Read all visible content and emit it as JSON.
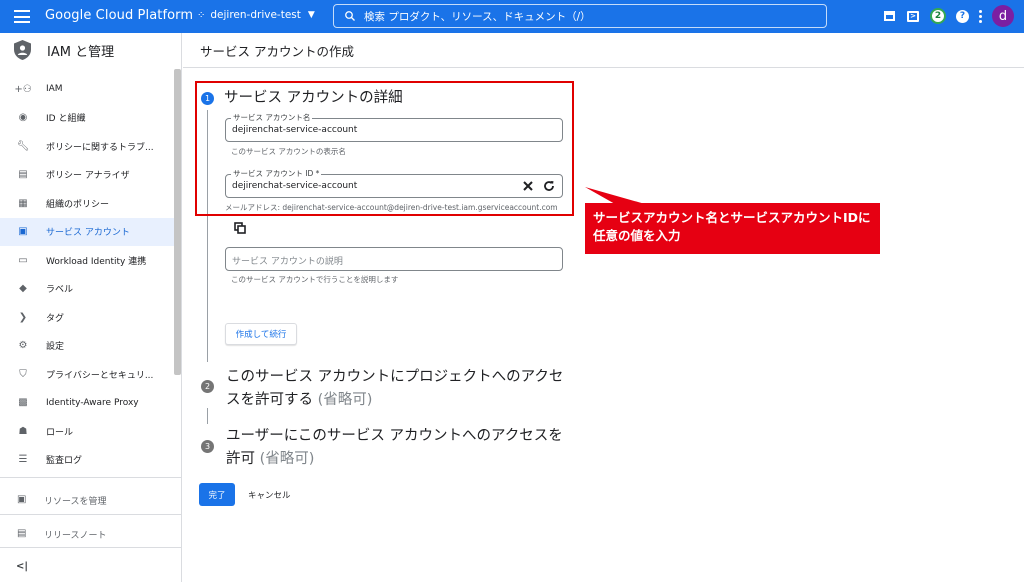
{
  "topbar": {
    "brand": "Google Cloud Platform",
    "project": "dejiren-drive-test",
    "search_placeholder": "検索 プロダクト、リソース、ドキュメント（/）",
    "notifications_count": "2",
    "avatar_initial": "d",
    "color": "#1a73e8"
  },
  "sidebar": {
    "title": "IAM と管理",
    "items": [
      {
        "label": "IAM",
        "icon": "person-add-icon"
      },
      {
        "label": "ID と組織",
        "icon": "account-circle-icon"
      },
      {
        "label": "ポリシーに関するトラブ...",
        "icon": "wrench-icon"
      },
      {
        "label": "ポリシー アナライザ",
        "icon": "policy-analyzer-icon"
      },
      {
        "label": "組織のポリシー",
        "icon": "document-icon"
      },
      {
        "label": "サービス アカウント",
        "icon": "service-account-icon",
        "active": true
      },
      {
        "label": "Workload Identity 連携",
        "icon": "id-card-icon"
      },
      {
        "label": "ラベル",
        "icon": "label-icon"
      },
      {
        "label": "タグ",
        "icon": "tag-icon"
      },
      {
        "label": "設定",
        "icon": "gear-icon"
      },
      {
        "label": "プライバシーとセキュリ...",
        "icon": "shield-icon"
      },
      {
        "label": "Identity-Aware Proxy",
        "icon": "proxy-icon"
      },
      {
        "label": "ロール",
        "icon": "roles-icon"
      },
      {
        "label": "監査ログ",
        "icon": "list-icon"
      }
    ],
    "footer": [
      {
        "label": "リソースを管理",
        "icon": "folder-gear-icon"
      },
      {
        "label": "リリースノート",
        "icon": "notes-icon"
      }
    ],
    "collapse_label": "<|"
  },
  "main": {
    "page_title": "サービス アカウントの作成",
    "step1": {
      "number": "1",
      "title": "サービス アカウントの詳細",
      "name_field": {
        "label": "サービス アカウント名",
        "value": "dejirenchat-service-account",
        "hint": "このサービス アカウントの表示名"
      },
      "id_field": {
        "label": "サービス アカウント ID *",
        "value": "dejirenchat-service-account"
      },
      "email_hint": "メールアドレス: dejirenchat-service-account@dejiren-drive-test.iam.gserviceaccount.com",
      "description_field": {
        "placeholder": "サービス アカウントの説明",
        "hint": "このサービス アカウントで行うことを説明します"
      },
      "create_button": "作成して続行"
    },
    "step2": {
      "number": "2",
      "title_line1": "このサービス アカウントにプロジェクトへのアクセ",
      "title_line2": "スを許可する",
      "optional": "(省略可)"
    },
    "step3": {
      "number": "3",
      "title_line1": "ユーザーにこのサービス アカウントへのアクセスを",
      "title_line2": "許可",
      "optional": "(省略可)"
    },
    "done_button": "完了",
    "cancel_button": "キャンセル"
  },
  "annotation": {
    "line1": "サービスアカウント名とサービスアカウントIDに",
    "line2": "任意の値を入力",
    "color": "#e60012"
  }
}
